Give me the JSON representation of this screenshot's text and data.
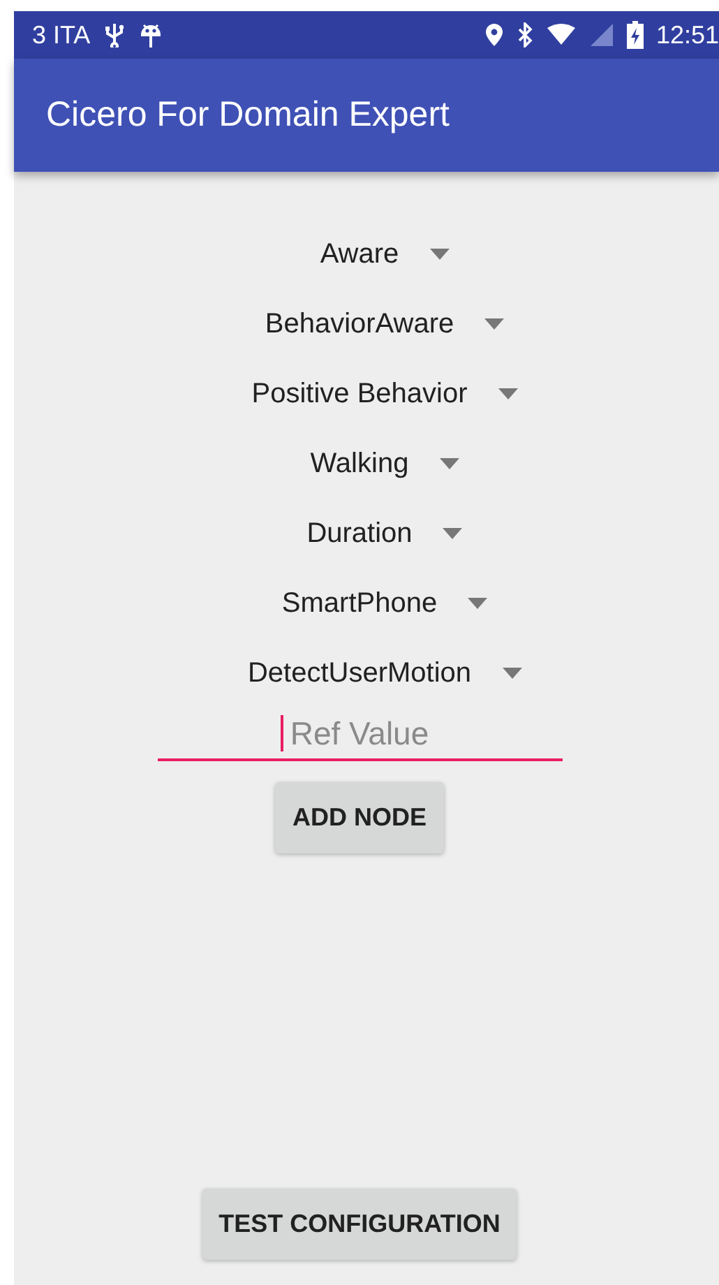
{
  "status_bar": {
    "carrier": "3 ITA",
    "time": "12:51"
  },
  "app_bar": {
    "title": "Cicero For Domain Expert"
  },
  "spinners": [
    {
      "value": "Aware"
    },
    {
      "value": "BehaviorAware"
    },
    {
      "value": "Positive Behavior"
    },
    {
      "value": "Walking"
    },
    {
      "value": "Duration"
    },
    {
      "value": "SmartPhone"
    },
    {
      "value": "DetectUserMotion"
    }
  ],
  "ref_field": {
    "placeholder": "Ref Value",
    "focused": true
  },
  "add_button": "ADD NODE",
  "test_button": "TEST CONFIGURATION"
}
